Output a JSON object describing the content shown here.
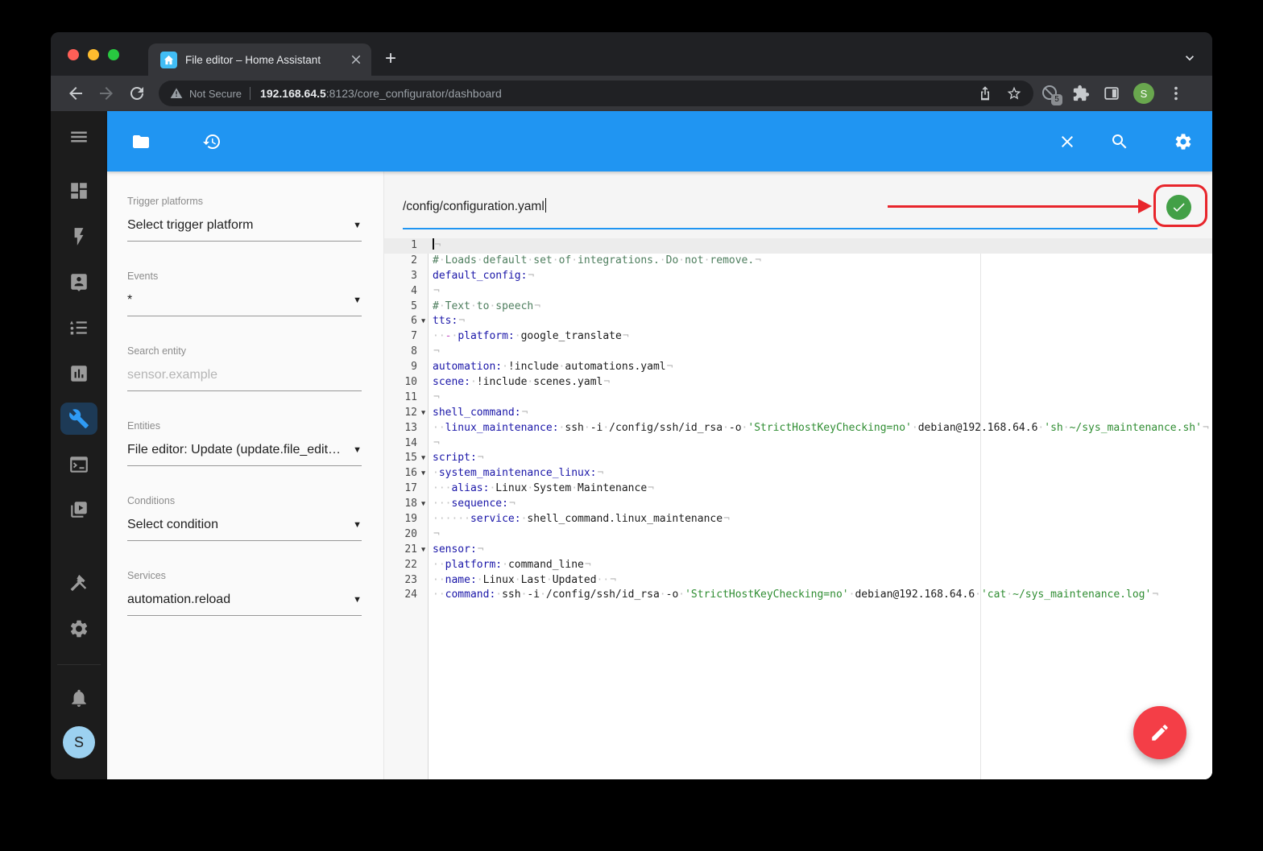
{
  "browser": {
    "traffic_lights": [
      "close",
      "minimize",
      "zoom"
    ],
    "tab_title": "File editor – Home Assistant",
    "new_tab_label": "+",
    "address": {
      "warning_label": "Not Secure",
      "host": "192.168.64.5",
      "path": ":8123/core_configurator/dashboard"
    },
    "extensions_badge": "5",
    "profile_initial": "S"
  },
  "app": {
    "toolbar": {
      "left_icons": [
        "folder",
        "history-arrow"
      ],
      "right_icons": [
        "close",
        "search",
        "settings"
      ]
    },
    "sidebar": {
      "items": [
        {
          "id": "overview",
          "icon": "view-dashboard",
          "active": false
        },
        {
          "id": "energy",
          "icon": "lightning-bolt",
          "active": false
        },
        {
          "id": "map",
          "icon": "account-badge",
          "active": false
        },
        {
          "id": "logbook",
          "icon": "list-bulleted",
          "active": false
        },
        {
          "id": "history",
          "icon": "chart-box",
          "active": false
        },
        {
          "id": "file-editor",
          "icon": "wrench",
          "active": true
        },
        {
          "id": "terminal",
          "icon": "terminal",
          "active": false
        },
        {
          "id": "media-browser",
          "icon": "media-play",
          "active": false
        },
        {
          "id": "developer-tools",
          "icon": "hammer",
          "active": false
        },
        {
          "id": "settings",
          "icon": "cog",
          "active": false
        }
      ],
      "user_initial": "S"
    },
    "panel": {
      "fields": [
        {
          "label": "Trigger platforms",
          "value": "Select trigger platform",
          "arrow": true
        },
        {
          "label": "Events",
          "value": "*",
          "arrow": true
        },
        {
          "label": "Search entity",
          "placeholder": "sensor.example",
          "arrow": false
        },
        {
          "label": "Entities",
          "value": "File editor: Update (update.file_edit…",
          "arrow": true
        },
        {
          "label": "Conditions",
          "value": "Select condition",
          "arrow": true
        },
        {
          "label": "Services",
          "value": "automation.reload",
          "arrow": true
        }
      ]
    },
    "editor": {
      "filename": "/config/configuration.yaml",
      "return_mark": "¬",
      "lines": [
        {
          "n": 1,
          "active": true,
          "cursor": true,
          "segs": []
        },
        {
          "n": 2,
          "segs": [
            [
              "c",
              "# Loads default set of integrations. Do not remove."
            ]
          ]
        },
        {
          "n": 3,
          "segs": [
            [
              "k",
              "default_config:"
            ]
          ]
        },
        {
          "n": 4,
          "segs": []
        },
        {
          "n": 5,
          "segs": [
            [
              "c",
              "# Text to speech"
            ]
          ]
        },
        {
          "n": 6,
          "fold": true,
          "segs": [
            [
              "k",
              "tts:"
            ]
          ]
        },
        {
          "n": 7,
          "segs": [
            [
              "p",
              "  "
            ],
            [
              "d",
              "-"
            ],
            [
              "p",
              " "
            ],
            [
              "k",
              "platform:"
            ],
            [
              "p",
              " google_translate"
            ]
          ]
        },
        {
          "n": 8,
          "segs": []
        },
        {
          "n": 9,
          "segs": [
            [
              "k",
              "automation:"
            ],
            [
              "p",
              " !include automations.yaml"
            ]
          ]
        },
        {
          "n": 10,
          "segs": [
            [
              "k",
              "scene:"
            ],
            [
              "p",
              " !include scenes.yaml"
            ]
          ]
        },
        {
          "n": 11,
          "segs": []
        },
        {
          "n": 12,
          "fold": true,
          "segs": [
            [
              "k",
              "shell_command:"
            ]
          ]
        },
        {
          "n": 13,
          "segs": [
            [
              "p",
              "  "
            ],
            [
              "k",
              "linux_maintenance:"
            ],
            [
              "p",
              " ssh -i /config/ssh/id_rsa -o "
            ],
            [
              "s",
              "'StrictHostKeyChecking=no'"
            ],
            [
              "p",
              " debian@192.168.64.6 "
            ],
            [
              "s",
              "'sh ~/sys_maintenance.sh'"
            ]
          ]
        },
        {
          "n": 14,
          "segs": []
        },
        {
          "n": 15,
          "fold": true,
          "segs": [
            [
              "k",
              "script:"
            ]
          ]
        },
        {
          "n": 16,
          "fold": true,
          "segs": [
            [
              "p",
              " "
            ],
            [
              "k",
              "system_maintenance_linux:"
            ]
          ]
        },
        {
          "n": 17,
          "segs": [
            [
              "p",
              "   "
            ],
            [
              "k",
              "alias:"
            ],
            [
              "p",
              " Linux System Maintenance"
            ]
          ]
        },
        {
          "n": 18,
          "fold": true,
          "segs": [
            [
              "p",
              "   "
            ],
            [
              "k",
              "sequence:"
            ]
          ]
        },
        {
          "n": 19,
          "segs": [
            [
              "p",
              "      "
            ],
            [
              "k",
              "service:"
            ],
            [
              "p",
              " shell_command.linux_maintenance"
            ]
          ]
        },
        {
          "n": 20,
          "segs": []
        },
        {
          "n": 21,
          "fold": true,
          "segs": [
            [
              "k",
              "sensor:"
            ]
          ]
        },
        {
          "n": 22,
          "segs": [
            [
              "p",
              "  "
            ],
            [
              "k",
              "platform:"
            ],
            [
              "p",
              " command_line"
            ]
          ]
        },
        {
          "n": 23,
          "segs": [
            [
              "p",
              "  "
            ],
            [
              "k",
              "name:"
            ],
            [
              "p",
              " Linux Last Updated  "
            ]
          ]
        },
        {
          "n": 24,
          "segs": [
            [
              "p",
              "  "
            ],
            [
              "k",
              "command:"
            ],
            [
              "p",
              " ssh -i /config/ssh/id_rsa -o "
            ],
            [
              "s",
              "'StrictHostKeyChecking=no'"
            ],
            [
              "p",
              " debian@192.168.64.6 "
            ],
            [
              "s",
              "'cat ~/sys_maintenance.log'"
            ]
          ]
        }
      ]
    }
  },
  "colors": {
    "accent_blue": "#2095f2",
    "annotation_red": "#e8252b",
    "save_check_green": "#43a047",
    "fab_red": "#f43e47",
    "ha_brand_blue": "#41bdf5",
    "comment_green": "#4e7e5e",
    "key_blue": "#1a16a8",
    "string_green": "#2f8d32"
  }
}
